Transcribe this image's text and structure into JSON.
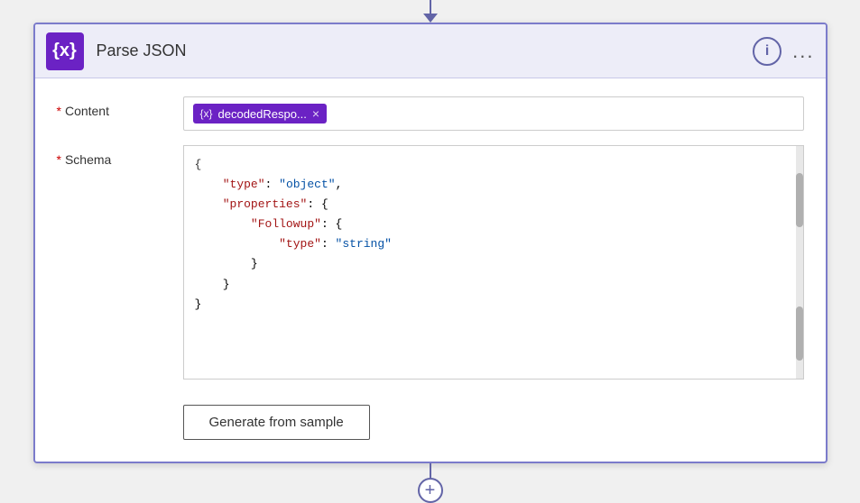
{
  "connector": {
    "top_arrow": "↓",
    "bottom_plus": "+"
  },
  "header": {
    "icon_symbol": "{x}",
    "title": "Parse JSON",
    "info_label": "i",
    "more_label": "..."
  },
  "fields": {
    "content": {
      "label": "Content",
      "required": "*",
      "token_icon": "{x}",
      "token_text": "decodedRespo...",
      "token_close": "×"
    },
    "schema": {
      "label": "Schema",
      "required": "*",
      "json_lines": [
        {
          "indent": 0,
          "content": "{",
          "type": "brace"
        },
        {
          "indent": 1,
          "key": "\"type\"",
          "value": "\"object\"",
          "comma": true
        },
        {
          "indent": 1,
          "key": "\"properties\"",
          "value": "{",
          "comma": false
        },
        {
          "indent": 2,
          "key": "\"Followup\"",
          "value": "{",
          "comma": false
        },
        {
          "indent": 3,
          "key": "\"type\"",
          "value": "\"string\"",
          "comma": false
        },
        {
          "indent": 2,
          "content": "}",
          "type": "brace"
        },
        {
          "indent": 1,
          "content": "}",
          "type": "brace"
        },
        {
          "indent": 0,
          "content": "}",
          "type": "brace"
        }
      ]
    }
  },
  "buttons": {
    "generate_label": "Generate from sample"
  }
}
